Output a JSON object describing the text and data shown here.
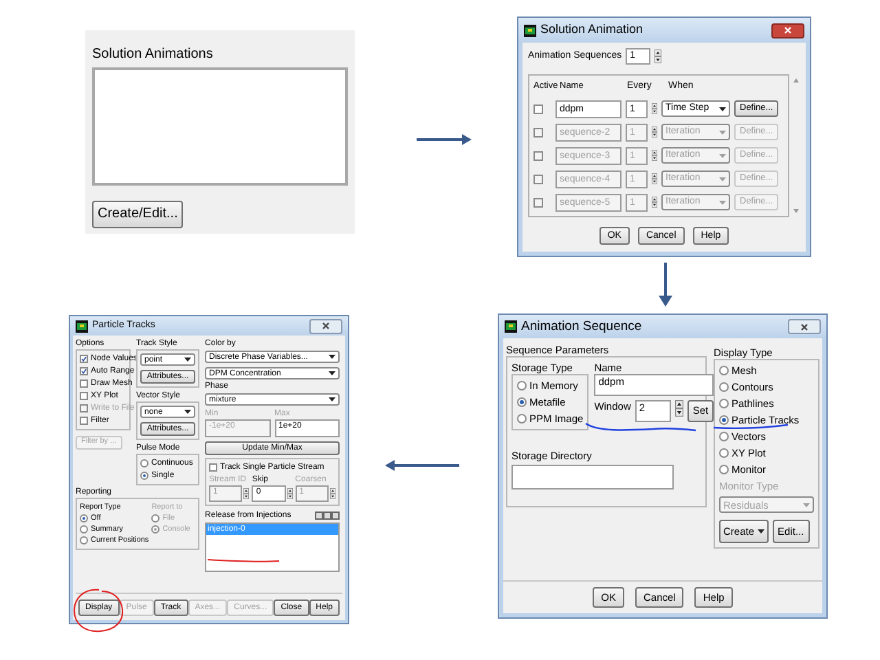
{
  "solution_animations_panel": {
    "title": "Solution Animations",
    "create_button": "Create/Edit..."
  },
  "solution_animation": {
    "title": "Solution Animation",
    "sequences_label": "Animation Sequences",
    "sequences_value": "1",
    "columns": [
      "Active",
      "Name",
      "Every",
      "When"
    ],
    "rows": [
      {
        "active": false,
        "disabled": false,
        "name": "ddpm",
        "every": "1",
        "when": "Time Step",
        "define": "Define..."
      },
      {
        "active": false,
        "disabled": true,
        "name": "sequence-2",
        "every": "1",
        "when": "Iteration",
        "define": "Define..."
      },
      {
        "active": false,
        "disabled": true,
        "name": "sequence-3",
        "every": "1",
        "when": "Iteration",
        "define": "Define..."
      },
      {
        "active": false,
        "disabled": true,
        "name": "sequence-4",
        "every": "1",
        "when": "Iteration",
        "define": "Define..."
      },
      {
        "active": false,
        "disabled": true,
        "name": "sequence-5",
        "every": "1",
        "when": "Iteration",
        "define": "Define..."
      }
    ],
    "buttons": [
      "OK",
      "Cancel",
      "Help"
    ]
  },
  "animation_sequence": {
    "title": "Animation Sequence",
    "parameters_label": "Sequence Parameters",
    "storage_type_label": "Storage Type",
    "storage_types": [
      {
        "label": "In Memory",
        "selected": false
      },
      {
        "label": "Metafile",
        "selected": true
      },
      {
        "label": "PPM Image",
        "selected": false
      }
    ],
    "name_label": "Name",
    "name_value": "ddpm",
    "window_label": "Window",
    "window_value": "2",
    "set_button": "Set",
    "storage_directory_label": "Storage Directory",
    "display_type_label": "Display Type",
    "display_types": [
      {
        "label": "Mesh",
        "selected": false
      },
      {
        "label": "Contours",
        "selected": false
      },
      {
        "label": "Pathlines",
        "selected": false
      },
      {
        "label": "Particle Tracks",
        "selected": true
      },
      {
        "label": "Vectors",
        "selected": false
      },
      {
        "label": "XY Plot",
        "selected": false
      },
      {
        "label": "Monitor",
        "selected": false
      }
    ],
    "monitor_type_label": "Monitor Type",
    "monitor_type_value": "Residuals",
    "create_button": "Create",
    "edit_button": "Edit...",
    "buttons": [
      "OK",
      "Cancel",
      "Help"
    ]
  },
  "particle_tracks": {
    "title": "Particle Tracks",
    "options_label": "Options",
    "options": [
      {
        "label": "Node Values",
        "checked": true,
        "disabled": false
      },
      {
        "label": "Auto Range",
        "checked": true,
        "disabled": false
      },
      {
        "label": "Draw Mesh",
        "checked": false,
        "disabled": false
      },
      {
        "label": "XY Plot",
        "checked": false,
        "disabled": false
      },
      {
        "label": "Write to File",
        "checked": false,
        "disabled": true
      },
      {
        "label": "Filter",
        "checked": false,
        "disabled": false
      }
    ],
    "filter_button": "Filter by ...",
    "track_style_label": "Track Style",
    "track_style_value": "point",
    "track_attributes": "Attributes...",
    "vector_style_label": "Vector Style",
    "vector_style_value": "none",
    "vector_attributes": "Attributes...",
    "pulse_mode_label": "Pulse Mode",
    "pulse_modes": [
      {
        "label": "Continuous",
        "selected": false
      },
      {
        "label": "Single",
        "selected": true
      }
    ],
    "color_by_label": "Color by",
    "color_by_value": "Discrete Phase Variables...",
    "color_by_sub_value": "DPM Concentration",
    "phase_label": "Phase",
    "phase_value": "mixture",
    "min_label": "Min",
    "min_value": "-1e+20",
    "max_label": "Max",
    "max_value": "1e+20",
    "update_button": "Update Min/Max",
    "track_single": {
      "label": "Track Single Particle Stream",
      "checked": false
    },
    "stream_fields": [
      {
        "label": "Stream ID",
        "value": "1",
        "disabled": true
      },
      {
        "label": "Skip",
        "value": "0",
        "disabled": false
      },
      {
        "label": "Coarsen",
        "value": "1",
        "disabled": true
      }
    ],
    "reporting_label": "Reporting",
    "report_type_label": "Report Type",
    "report_types": [
      {
        "label": "Off",
        "selected": true
      },
      {
        "label": "Summary",
        "selected": false
      },
      {
        "label": "Current Positions",
        "selected": false
      }
    ],
    "report_to_label": "Report to",
    "report_to_disabled": true,
    "report_to": [
      {
        "label": "File",
        "selected": false
      },
      {
        "label": "Console",
        "selected": true
      }
    ],
    "injections_label": "Release from Injections",
    "injections": [
      {
        "label": "injection-0",
        "selected": true
      }
    ],
    "buttons": [
      {
        "label": "Display",
        "disabled": false
      },
      {
        "label": "Pulse",
        "disabled": true
      },
      {
        "label": "Track",
        "disabled": false
      },
      {
        "label": "Axes...",
        "disabled": true
      },
      {
        "label": "Curves...",
        "disabled": true
      },
      {
        "label": "Close",
        "disabled": false
      },
      {
        "label": "Help",
        "disabled": false
      }
    ]
  }
}
